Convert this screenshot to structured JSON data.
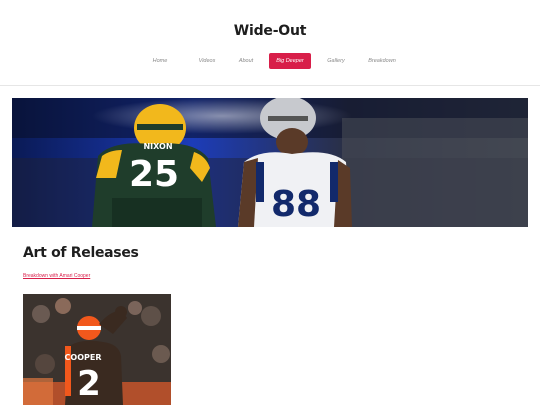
{
  "site": {
    "title": "Wide-Out"
  },
  "nav": {
    "items": [
      {
        "label": "Home"
      },
      {
        "label": "Videos"
      },
      {
        "label": "About"
      },
      {
        "label": "Big Deeper",
        "active": true
      },
      {
        "label": "Gallery"
      },
      {
        "label": "Breakdown"
      }
    ]
  },
  "hero": {
    "players": [
      {
        "jersey_number": "25",
        "name_on_jersey": "NIXON",
        "team_colors": [
          "#1f3d2b",
          "#f2b81c"
        ]
      },
      {
        "jersey_number": "88",
        "team_colors": [
          "#f0f1f4",
          "#12296b"
        ]
      }
    ]
  },
  "content": {
    "heading": "Art of Releases",
    "link_text": "Breakdown with Amari Cooper"
  },
  "thumbnail": {
    "player": {
      "jersey_number": "2",
      "name_on_jersey": "COOPER",
      "team_colors": [
        "#3a2a20",
        "#f2581c"
      ]
    }
  },
  "colors": {
    "accent": "#d81e49",
    "nav_text": "#8a8a8a",
    "title": "#1e1e1e"
  }
}
